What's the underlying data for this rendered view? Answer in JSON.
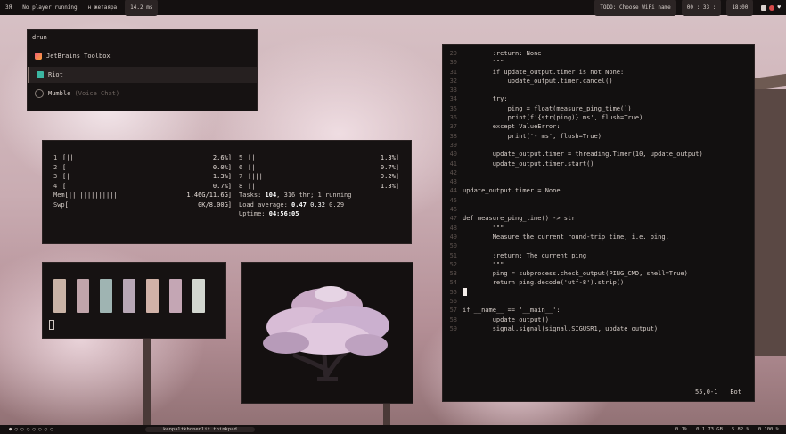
{
  "topbar": {
    "left_items": [
      "ЗЯ",
      "No player running",
      "н жетаяра",
      "14.2 ms"
    ],
    "right_items": [
      "TODO: Choose WiFi name",
      "00 : 33 :",
      "18:00"
    ]
  },
  "bottombar": {
    "center_label": "kenpaltkhonenlit thinkpad",
    "right_items": [
      "0 1%",
      "0 1.73 GB",
      "5.82 %",
      "0 100 %"
    ]
  },
  "launcher": {
    "query": "drun",
    "items": [
      {
        "label": "JetBrains Toolbox",
        "hint": ""
      },
      {
        "label": "Riot",
        "hint": ""
      },
      {
        "label": "Mumble",
        "hint": "(Voice Chat)"
      }
    ]
  },
  "htop": {
    "cpus_left": [
      {
        "n": "1",
        "bar": "[||",
        "pct": "2.6%]"
      },
      {
        "n": "2",
        "bar": "[",
        "pct": "0.0%]"
      },
      {
        "n": "3",
        "bar": "[|",
        "pct": "1.3%]"
      },
      {
        "n": "4",
        "bar": "[",
        "pct": "0.7%]"
      }
    ],
    "cpus_right": [
      {
        "n": "5",
        "bar": "[|",
        "pct": "1.3%]"
      },
      {
        "n": "6",
        "bar": "[|",
        "pct": "0.7%]"
      },
      {
        "n": "7",
        "bar": "[|||",
        "pct": "9.2%]"
      },
      {
        "n": "8",
        "bar": "[|",
        "pct": "1.3%]"
      }
    ],
    "mem": {
      "label": "Mem",
      "bar": "[|||||||||||||",
      "value": "1.46G/11.6G]"
    },
    "swp": {
      "label": "Swp",
      "bar": "[",
      "value": "0K/8.00G]"
    },
    "tasks_prefix": "Tasks:",
    "tasks_count": "104",
    "tasks_rest": ", 316 thr; 1 running",
    "load_prefix": "Load average:",
    "load_1": "0.47",
    "load_5": "0.32",
    "load_15": "0.29",
    "uptime_prefix": "Uptime:",
    "uptime": "04:56:05"
  },
  "palette": {
    "colors": [
      "#c9b3a6",
      "#c0a4aa",
      "#9fb4b2",
      "#b8a7b5",
      "#d1b2a8",
      "#c4a6b4",
      "#d2d6cf"
    ]
  },
  "editor": {
    "lines": [
      {
        "n": "29",
        "t": "        :return: None"
      },
      {
        "n": "30",
        "t": "        \"\"\""
      },
      {
        "n": "31",
        "t": "        if update_output.timer is not None:"
      },
      {
        "n": "32",
        "t": "            update_output.timer.cancel()"
      },
      {
        "n": "33",
        "t": ""
      },
      {
        "n": "34",
        "t": "        try:"
      },
      {
        "n": "35",
        "t": "            ping = float(measure_ping_time())"
      },
      {
        "n": "36",
        "t": "            print(f'{str(ping)} ms', flush=True)"
      },
      {
        "n": "37",
        "t": "        except ValueError:"
      },
      {
        "n": "38",
        "t": "            print('- ms', flush=True)"
      },
      {
        "n": "39",
        "t": ""
      },
      {
        "n": "40",
        "t": "        update_output.timer = threading.Timer(10, update_output)"
      },
      {
        "n": "41",
        "t": "        update_output.timer.start()"
      },
      {
        "n": "42",
        "t": ""
      },
      {
        "n": "43",
        "t": ""
      },
      {
        "n": "44",
        "t": "update_output.timer = None"
      },
      {
        "n": "45",
        "t": ""
      },
      {
        "n": "46",
        "t": ""
      },
      {
        "n": "47",
        "t": "def measure_ping_time() -> str:"
      },
      {
        "n": "48",
        "t": "        \"\"\""
      },
      {
        "n": "49",
        "t": "        Measure the current round-trip time, i.e. ping."
      },
      {
        "n": "50",
        "t": ""
      },
      {
        "n": "51",
        "t": "        :return: The current ping"
      },
      {
        "n": "52",
        "t": "        \"\"\""
      },
      {
        "n": "53",
        "t": "        ping = subprocess.check_output(PING_CMD, shell=True)"
      },
      {
        "n": "54",
        "t": "        return ping.decode('utf-8').strip()"
      },
      {
        "n": "55",
        "t": ""
      },
      {
        "n": "56",
        "t": ""
      },
      {
        "n": "57",
        "t": "if __name__ == '__main__':"
      },
      {
        "n": "58",
        "t": "        update_output()"
      },
      {
        "n": "59",
        "t": "        signal.signal(signal.SIGUSR1, update_output)"
      }
    ],
    "status_pos": "55,0-1",
    "status_where": "Bot"
  }
}
